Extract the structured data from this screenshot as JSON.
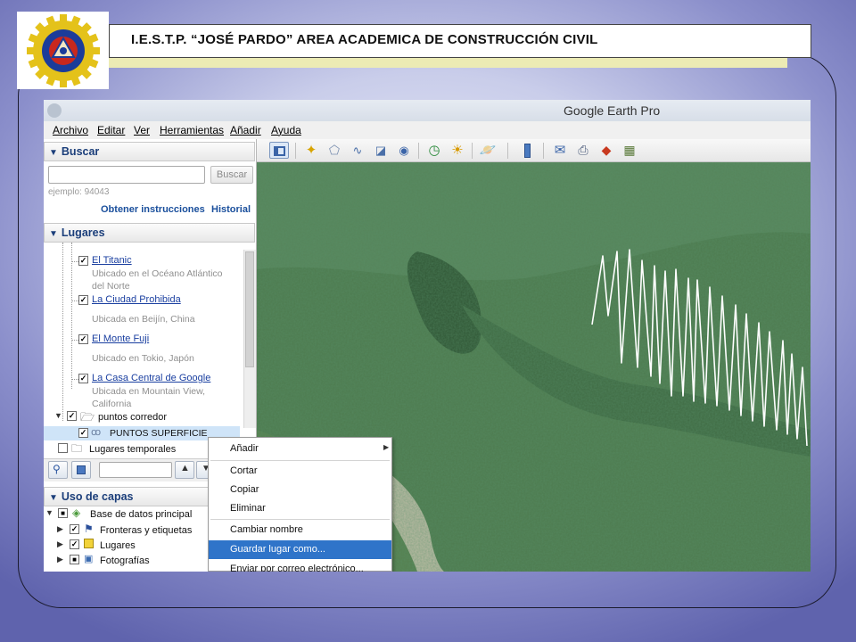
{
  "slide": {
    "title": "I.E.S.T.P. “JOSÉ PARDO” AREA ACADEMICA DE CONSTRUCCIÓN CIVIL",
    "logo_icon": "institute-gear-logo",
    "accent_color": "#ecebb4"
  },
  "app": {
    "window_title": "Google Earth Pro",
    "menu": [
      "Archivo",
      "Editar",
      "Ver",
      "Herramientas",
      "Añadir",
      "Ayuda"
    ],
    "search": {
      "header": "Buscar",
      "button": "Buscar",
      "example": "ejemplo: 94043",
      "link_directions": "Obtener instrucciones",
      "link_history": "Historial"
    },
    "places": {
      "header": "Lugares",
      "items": [
        {
          "label": "El Titanic",
          "desc": "Ubicado en el Océano Atlántico del Norte"
        },
        {
          "label": "La Ciudad Prohibida",
          "desc": "Ubicada en Beijín, China"
        },
        {
          "label": "El Monte Fuji",
          "desc": "Ubicado en Tokio, Japón"
        },
        {
          "label": "La Casa Central de Google",
          "desc": "Ubicada en Mountain View, California"
        }
      ],
      "folder_corredor": "puntos corredor",
      "selected_item": "PUNTOS SUPERFICIE",
      "folder_temp": "Lugares temporales"
    },
    "layers": {
      "header": "Uso de capas",
      "items": [
        "Base de datos principal",
        "Fronteras y etiquetas",
        "Lugares",
        "Fotografías"
      ]
    },
    "context_menu": {
      "items": [
        "Añadir",
        "Cortar",
        "Copiar",
        "Eliminar",
        "Cambiar nombre",
        "Guardar lugar como...",
        "Enviar por correo electrónico..."
      ],
      "highlighted": "Guardar lugar como..."
    },
    "toolbar_icons": [
      "sidebar-toggle-icon",
      "placemark-icon",
      "polygon-icon",
      "path-icon",
      "overlay-icon",
      "tour-icon",
      "historical-imagery-icon",
      "sunlight-icon",
      "planets-icon",
      "ruler-icon",
      "email-icon",
      "print-icon",
      "google-maps-icon",
      "kml-icon"
    ],
    "map_route_color": "#ffffff"
  }
}
